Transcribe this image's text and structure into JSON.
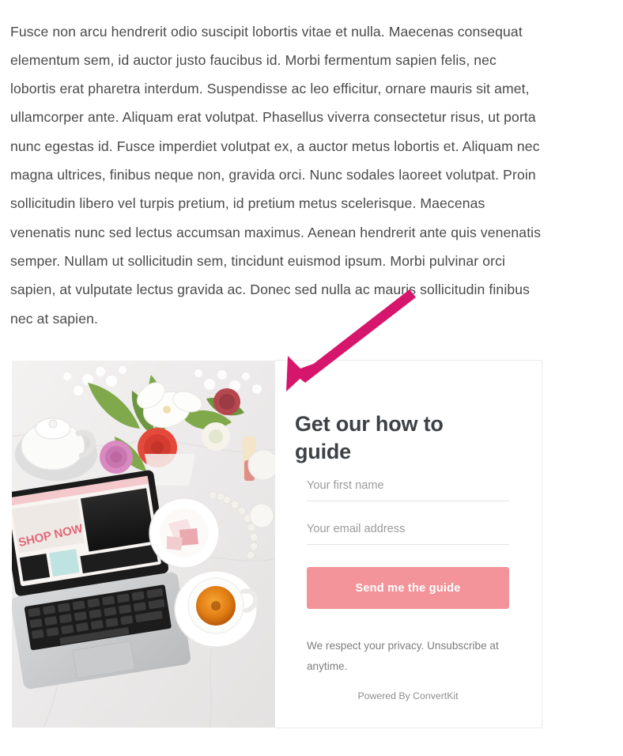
{
  "article": {
    "paragraph": "Fusce non arcu hendrerit odio suscipit lobortis vitae et nulla. Maecenas consequat elementum sem, id auctor justo faucibus id. Morbi fermentum sapien felis, nec lobortis erat pharetra interdum. Suspendisse ac leo efficitur, ornare mauris sit amet, ullamcorper ante. Aliquam erat volutpat. Phasellus viverra consectetur risus, ut porta nunc egestas id. Fusce imperdiet volutpat ex, a auctor metus lobortis et. Aliquam nec magna ultrices, finibus neque non, gravida orci. Nunc sodales laoreet volutpat. Proin sollicitudin libero vel turpis pretium, id pretium metus scelerisque. Maecenas venenatis nunc sed lectus accumsan maximus. Aenean hendrerit ante quis venenatis semper. Nullam ut sollicitudin sem, tincidunt euismod ipsum. Morbi pulvinar orci sapien, at vulputate lectus gravida ac. Donec sed nulla ac mauris sollicitudin finibus nec at sapien."
  },
  "optin_form": {
    "heading": "Get our how to guide",
    "first_name": {
      "placeholder": "Your first name",
      "value": ""
    },
    "email": {
      "placeholder": "Your email address",
      "value": ""
    },
    "submit_label": "Send me the guide",
    "privacy_note": "We respect your privacy. Unsubscribe at anytime.",
    "powered_by": "Powered By ConvertKit",
    "photo_alt": "flatlay-photo-flowers-laptop-tea",
    "colors": {
      "button": "#f2949a",
      "button_text": "#ffffff",
      "heading": "#3d4146",
      "placeholder": "#9b9b9b",
      "field_underline": "#e2e2e2",
      "card_border": "#eaeaea",
      "muted_text": "#7d7d7d"
    }
  },
  "annotation": {
    "arrow_name": "pointer-arrow",
    "color": "#d6156c",
    "points_to": "Get our how to guide"
  }
}
